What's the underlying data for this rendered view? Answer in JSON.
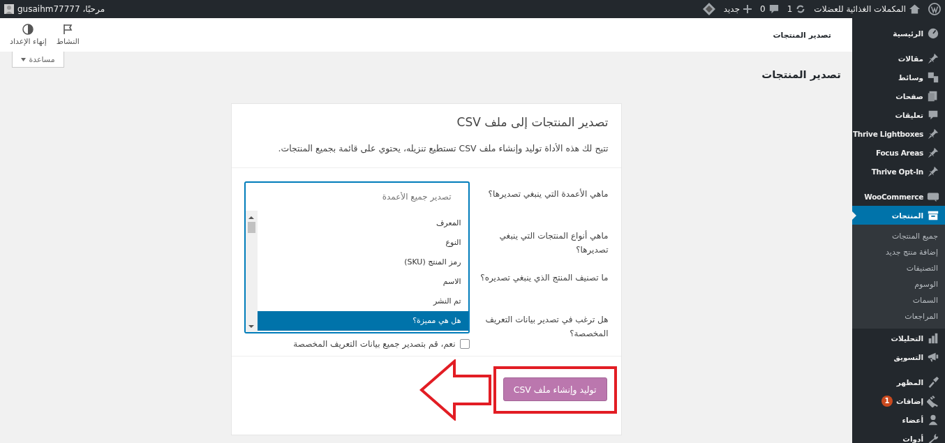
{
  "admin_bar": {
    "site_name": "المكملات الغذائية للعضلات",
    "updates": "1",
    "comments": "0",
    "new": "جديد",
    "greeting": "مرحبًا، gusaihm77777"
  },
  "header": {
    "title": "تصدير المنتجات",
    "actions": [
      {
        "label": "النشاط"
      },
      {
        "label": "إنهاء الإعداد"
      }
    ]
  },
  "help_tab": "مساعدة",
  "page_title": "تصدير المنتجات",
  "card": {
    "title": "تصدير المنتجات إلى ملف CSV",
    "description": "تتيح لك هذه الأداة توليد وإنشاء ملف CSV تستطيع تنزيله، يحتوي على قائمة بجميع المنتجات.",
    "rows": [
      {
        "label": "ماهي الأعمدة التي ينبغي تصديرها؟",
        "kind": "select",
        "placeholder": "تصدير جميع الأعمدة",
        "options": [
          {
            "label": "المعرف",
            "selected": false
          },
          {
            "label": "النوع",
            "selected": false
          },
          {
            "label": "رمز المنتج (SKU)",
            "selected": false
          },
          {
            "label": "الاسم",
            "selected": false
          },
          {
            "label": "تم النشر",
            "selected": false
          },
          {
            "label": "هل هي مميزة؟",
            "selected": true
          }
        ]
      },
      {
        "label": "ماهي أنواع المنتجات التي ينبغي تصديرها؟"
      },
      {
        "label": "ما تصنيف المنتج الذي ينبغي تصديره؟"
      },
      {
        "label": "هل ترغب في تصدير بيانات التعريف المخصصة؟",
        "kind": "checkbox",
        "checked": false,
        "text": "نعم، قم بتصدير جميع بيانات التعريف المخصصة"
      }
    ],
    "button": "توليد وإنشاء ملف CSV"
  },
  "sidebar": {
    "groups": [
      [
        {
          "label": "الرئيسية",
          "selected": false
        }
      ],
      [
        {
          "label": "مقالات",
          "selected": false
        },
        {
          "label": "وسائط",
          "selected": false
        },
        {
          "label": "صفحات",
          "selected": false
        },
        {
          "label": "تعليقات",
          "selected": false
        },
        {
          "label": "Thrive Lightboxes",
          "selected": false
        },
        {
          "label": "Focus Areas",
          "selected": false
        },
        {
          "label": "Thrive Opt-In",
          "selected": false
        }
      ],
      [
        {
          "label": "WooCommerce",
          "selected": false
        },
        {
          "label": "المنتجات",
          "selected": true,
          "children": [
            {
              "label": "جميع المنتجات",
              "selected": false
            },
            {
              "label": "إضافة منتج جديد",
              "selected": false
            },
            {
              "label": "التصنيفات",
              "selected": false
            },
            {
              "label": "الوسوم",
              "selected": false
            },
            {
              "label": "السمات",
              "selected": false
            },
            {
              "label": "المراجعات",
              "selected": false
            }
          ]
        },
        {
          "label": "التحليلات",
          "selected": false
        },
        {
          "label": "التسويق",
          "selected": false
        }
      ],
      [
        {
          "label": "المظهر",
          "selected": false
        },
        {
          "label": "إضافات",
          "selected": false,
          "badge": "1"
        },
        {
          "label": "أعضاء",
          "selected": false
        },
        {
          "label": "أدوات",
          "selected": false
        }
      ]
    ]
  }
}
